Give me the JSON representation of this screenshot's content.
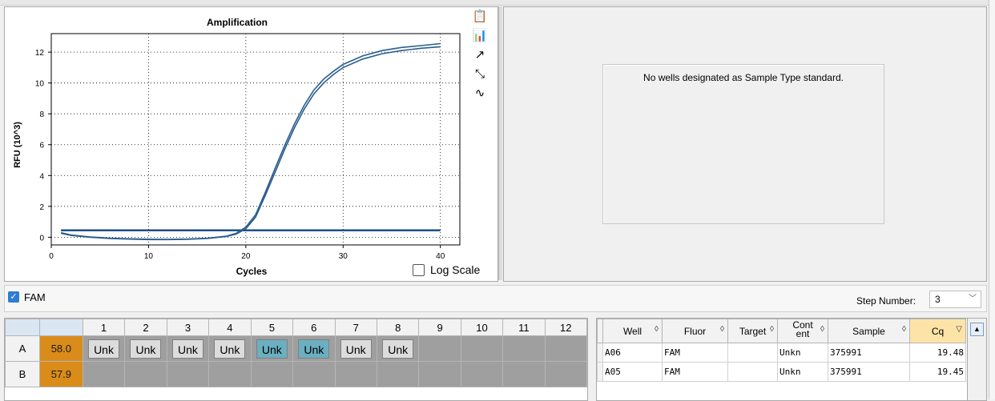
{
  "chart": {
    "title": "Amplification",
    "xlabel": "Cycles",
    "ylabel": "RFU (10^3)",
    "log_scale_label": "Log Scale",
    "log_scale_checked": false
  },
  "chart_data": {
    "type": "line",
    "title": "Amplification",
    "xlabel": "Cycles",
    "ylabel": "RFU (10^3)",
    "xlim": [
      0,
      42
    ],
    "ylim": [
      -0.5,
      13.2
    ],
    "xticks": [
      0,
      10,
      20,
      30,
      40
    ],
    "yticks": [
      0,
      2,
      4,
      6,
      8,
      10,
      12
    ],
    "grid": true,
    "threshold": 0.45,
    "series": [
      {
        "color": "#2a5d8f",
        "x": [
          1,
          2,
          4,
          6,
          8,
          10,
          12,
          14,
          16,
          18,
          19,
          20,
          21,
          22,
          23,
          24,
          25,
          26,
          27,
          28,
          29,
          30,
          32,
          34,
          36,
          38,
          40
        ],
        "values": [
          0.25,
          0.12,
          0.0,
          -0.08,
          -0.12,
          -0.15,
          -0.15,
          -0.13,
          -0.08,
          0.05,
          0.2,
          0.55,
          1.3,
          2.7,
          4.2,
          5.7,
          7.1,
          8.3,
          9.3,
          10.0,
          10.55,
          11.0,
          11.55,
          11.9,
          12.1,
          12.25,
          12.35
        ]
      },
      {
        "color": "#2a5d8f",
        "x": [
          1,
          2,
          4,
          6,
          8,
          10,
          12,
          14,
          16,
          18,
          19,
          20,
          21,
          22,
          23,
          24,
          25,
          26,
          27,
          28,
          29,
          30,
          32,
          34,
          36,
          38,
          40
        ],
        "values": [
          0.3,
          0.15,
          0.02,
          -0.06,
          -0.1,
          -0.13,
          -0.14,
          -0.12,
          -0.07,
          0.07,
          0.25,
          0.65,
          1.45,
          2.9,
          4.45,
          5.95,
          7.35,
          8.55,
          9.55,
          10.25,
          10.75,
          11.2,
          11.75,
          12.1,
          12.3,
          12.42,
          12.55
        ]
      }
    ]
  },
  "tools": [
    {
      "icon": "clipboard-icon",
      "glyph": "📋"
    },
    {
      "icon": "chart-settings-icon",
      "glyph": "📊"
    },
    {
      "icon": "export-icon",
      "glyph": "↗"
    },
    {
      "icon": "zoom-chart-icon",
      "glyph": "⤡"
    },
    {
      "icon": "curve-fit-icon",
      "glyph": "∿"
    }
  ],
  "standard_curve": {
    "message": "No wells designated as Sample Type standard."
  },
  "fluor_filter": {
    "label": "FAM",
    "checked": true
  },
  "step": {
    "label": "Step Number:",
    "value": "3"
  },
  "plate": {
    "columns": [
      "1",
      "2",
      "3",
      "4",
      "5",
      "6",
      "7",
      "8",
      "9",
      "10",
      "11",
      "12"
    ],
    "rows": [
      {
        "label": "A",
        "temp": "58.0",
        "wells": [
          "Unk",
          "Unk",
          "Unk",
          "Unk",
          "Unk",
          "Unk",
          "Unk",
          "Unk",
          "",
          "",
          "",
          ""
        ],
        "selected": [
          5,
          6
        ]
      },
      {
        "label": "B",
        "temp": "57.9",
        "wells": [
          "",
          "",
          "",
          "",
          "",
          "",
          "",
          "",
          "",
          "",
          "",
          ""
        ],
        "selected": []
      }
    ]
  },
  "results": {
    "headers": [
      "Well",
      "Fluor",
      "Target",
      "Content",
      "Sample",
      "Cq"
    ],
    "rows": [
      [
        "A06",
        "FAM",
        "",
        "Unkn",
        "375991",
        "19.48"
      ],
      [
        "A05",
        "FAM",
        "",
        "Unkn",
        "375991",
        "19.45"
      ]
    ]
  }
}
